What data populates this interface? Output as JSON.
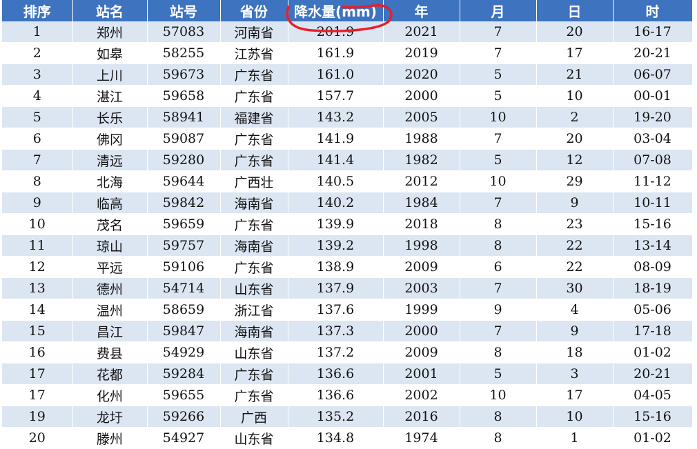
{
  "table": {
    "headers": [
      "排序",
      "站名",
      "站号",
      "省份",
      "降水量(mm)",
      "年",
      "月",
      "日",
      "时"
    ],
    "rows": [
      [
        "1",
        "郑州",
        "57083",
        "河南省",
        "201.9",
        "2021",
        "7",
        "20",
        "16-17"
      ],
      [
        "2",
        "如皋",
        "58255",
        "江苏省",
        "161.9",
        "2019",
        "7",
        "17",
        "20-21"
      ],
      [
        "3",
        "上川",
        "59673",
        "广东省",
        "161.0",
        "2020",
        "5",
        "21",
        "06-07"
      ],
      [
        "4",
        "湛江",
        "59658",
        "广东省",
        "157.7",
        "2000",
        "5",
        "10",
        "00-01"
      ],
      [
        "5",
        "长乐",
        "58941",
        "福建省",
        "143.2",
        "2005",
        "10",
        "2",
        "19-20"
      ],
      [
        "6",
        "佛冈",
        "59087",
        "广东省",
        "141.9",
        "1988",
        "7",
        "20",
        "03-04"
      ],
      [
        "7",
        "清远",
        "59280",
        "广东省",
        "141.4",
        "1982",
        "5",
        "12",
        "07-08"
      ],
      [
        "8",
        "北海",
        "59644",
        "广西壮",
        "140.5",
        "2012",
        "10",
        "29",
        "11-12"
      ],
      [
        "9",
        "临高",
        "59842",
        "海南省",
        "140.2",
        "1984",
        "7",
        "9",
        "10-11"
      ],
      [
        "10",
        "茂名",
        "59659",
        "广东省",
        "139.9",
        "2018",
        "8",
        "23",
        "15-16"
      ],
      [
        "11",
        "琼山",
        "59757",
        "海南省",
        "139.2",
        "1998",
        "8",
        "22",
        "13-14"
      ],
      [
        "12",
        "平远",
        "59106",
        "广东省",
        "138.9",
        "2009",
        "6",
        "22",
        "08-09"
      ],
      [
        "13",
        "德州",
        "54714",
        "山东省",
        "137.9",
        "2003",
        "7",
        "30",
        "18-19"
      ],
      [
        "14",
        "温州",
        "58659",
        "浙江省",
        "137.6",
        "1999",
        "9",
        "4",
        "05-06"
      ],
      [
        "15",
        "昌江",
        "59847",
        "海南省",
        "137.3",
        "2000",
        "7",
        "9",
        "17-18"
      ],
      [
        "16",
        "费县",
        "54929",
        "山东省",
        "137.2",
        "2009",
        "8",
        "18",
        "01-02"
      ],
      [
        "17",
        "花都",
        "59284",
        "广东省",
        "136.6",
        "2001",
        "5",
        "3",
        "20-21"
      ],
      [
        "17",
        "化州",
        "59655",
        "广东省",
        "136.6",
        "2002",
        "10",
        "17",
        "04-05"
      ],
      [
        "19",
        "龙圩",
        "59266",
        "广西",
        "135.2",
        "2016",
        "8",
        "10",
        "15-16"
      ],
      [
        "20",
        "滕州",
        "54927",
        "山东省",
        "134.8",
        "1974",
        "8",
        "1",
        "01-02"
      ]
    ]
  },
  "colors": {
    "header_bg": "#3d73bf",
    "header_text": "#ffffff",
    "band_bg": "#dce6f2",
    "annotation_stroke": "#e8202a"
  },
  "annotation": {
    "icon": "red-freehand-circle-icon"
  }
}
